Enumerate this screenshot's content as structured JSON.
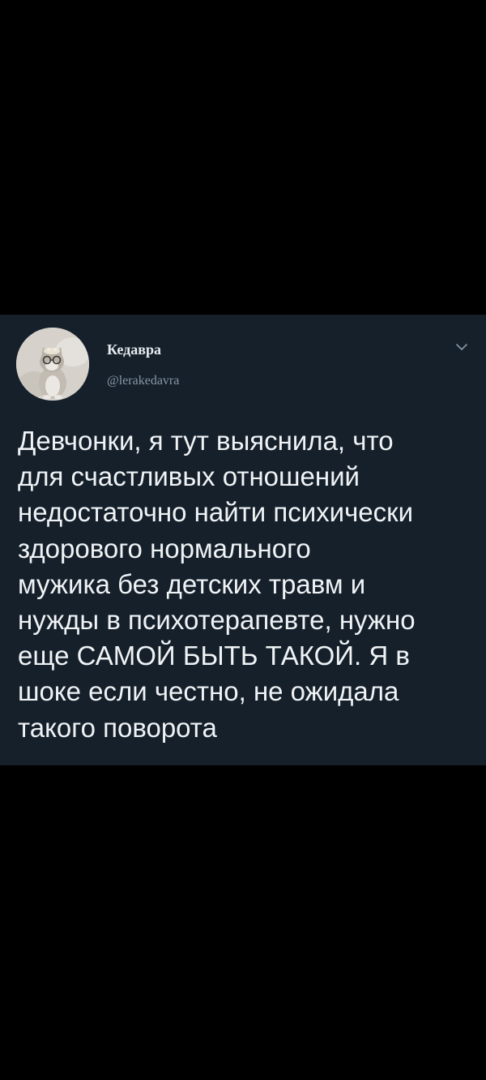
{
  "tweet": {
    "author": {
      "display_name": "Кедавра",
      "handle": "@lerakedavra",
      "avatar_icon": "cat-avatar"
    },
    "menu_icon": "chevron-down-icon",
    "text": "Девчонки, я тут выяснила, что\nдля счастливых отношений\nнедостаточно найти психически\nздорового нормального\nмужика без детских травм и\nнужды в психотерапевте, нужно\nеще САМОЙ БЫТЬ ТАКОЙ. Я в\nшоке если честно, не ожидала\nтакого поворота"
  },
  "colors": {
    "page_background": "#000000",
    "card_background": "#15202b",
    "text_primary": "#f0f3f5",
    "text_secondary": "#8899a6"
  }
}
